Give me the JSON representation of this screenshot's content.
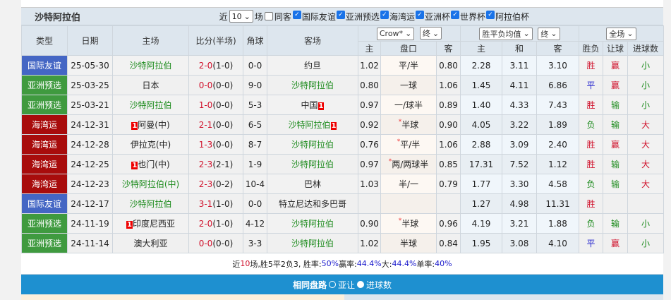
{
  "team": "沙特阿拉伯",
  "filters": {
    "near": "近",
    "count": "10",
    "unit": "场",
    "same_away": "同客",
    "leagues": [
      {
        "label": "国际友谊",
        "checked": true
      },
      {
        "label": "亚洲预选",
        "checked": true
      },
      {
        "label": "海湾运",
        "checked": true
      },
      {
        "label": "亚洲杯",
        "checked": true
      },
      {
        "label": "世界杯",
        "checked": true
      },
      {
        "label": "阿拉伯杯",
        "checked": true
      }
    ]
  },
  "header": {
    "type": "类型",
    "date": "日期",
    "home": "主场",
    "score": "比分(半场)",
    "corner": "角球",
    "away": "客场",
    "company": "Crow*",
    "final1": "终",
    "odds_type": "胜平负均值",
    "final2": "终",
    "scope": "全场",
    "sub": [
      "主",
      "盘口",
      "客",
      "主",
      "和",
      "客",
      "胜负",
      "让球",
      "进球数"
    ]
  },
  "colors": {
    "国际友谊": "#4466c4",
    "亚洲预选": "#3f9a3f",
    "海湾运": "#a80c0c"
  },
  "rows": [
    {
      "type": "国际友谊",
      "date": "25-05-30",
      "home": "沙特阿拉伯",
      "home_hl": true,
      "home_badge": "",
      "score": "2-0",
      "half": "(1-0)",
      "corner": "0-0",
      "away": "约旦",
      "away_hl": false,
      "away_badge": "",
      "h": "1.02",
      "line": "平/半",
      "star": false,
      "a": "0.80",
      "o1": "2.28",
      "o2": "3.11",
      "o3": "3.10",
      "res": "胜",
      "ah": "赢",
      "ou": "小"
    },
    {
      "type": "亚洲预选",
      "date": "25-03-25",
      "home": "日本",
      "home_hl": false,
      "home_badge": "",
      "score": "0-0",
      "half": "(0-0)",
      "corner": "9-0",
      "away": "沙特阿拉伯",
      "away_hl": true,
      "away_badge": "",
      "h": "0.80",
      "line": "一球",
      "star": false,
      "a": "1.06",
      "o1": "1.45",
      "o2": "4.11",
      "o3": "6.86",
      "res": "平",
      "ah": "赢",
      "ou": "小"
    },
    {
      "type": "亚洲预选",
      "date": "25-03-21",
      "home": "沙特阿拉伯",
      "home_hl": true,
      "home_badge": "",
      "score": "1-0",
      "half": "(0-0)",
      "corner": "5-3",
      "away": "中国",
      "away_hl": false,
      "away_badge": "1",
      "h": "0.97",
      "line": "一/球半",
      "star": false,
      "a": "0.89",
      "o1": "1.40",
      "o2": "4.33",
      "o3": "7.43",
      "res": "胜",
      "ah": "输",
      "ou": "小"
    },
    {
      "type": "海湾运",
      "date": "24-12-31",
      "home": "阿曼(中)",
      "home_hl": false,
      "home_badge": "1",
      "score": "2-1",
      "half": "(0-0)",
      "corner": "6-5",
      "away": "沙特阿拉伯",
      "away_hl": true,
      "away_badge": "1",
      "h": "0.92",
      "line": "半球",
      "star": true,
      "a": "0.90",
      "o1": "4.05",
      "o2": "3.22",
      "o3": "1.89",
      "res": "负",
      "ah": "输",
      "ou": "大"
    },
    {
      "type": "海湾运",
      "date": "24-12-28",
      "home": "伊拉克(中)",
      "home_hl": false,
      "home_badge": "",
      "score": "1-3",
      "half": "(0-0)",
      "corner": "8-7",
      "away": "沙特阿拉伯",
      "away_hl": true,
      "away_badge": "",
      "h": "0.76",
      "line": "平/半",
      "star": true,
      "a": "1.06",
      "o1": "2.88",
      "o2": "3.09",
      "o3": "2.40",
      "res": "胜",
      "ah": "赢",
      "ou": "大"
    },
    {
      "type": "海湾运",
      "date": "24-12-25",
      "home": "也门(中)",
      "home_hl": false,
      "home_badge": "1",
      "score": "2-3",
      "half": "(2-1)",
      "corner": "1-9",
      "away": "沙特阿拉伯",
      "away_hl": true,
      "away_badge": "",
      "h": "0.97",
      "line": "两/两球半",
      "star": true,
      "a": "0.85",
      "o1": "17.31",
      "o2": "7.52",
      "o3": "1.12",
      "res": "胜",
      "ah": "输",
      "ou": "大"
    },
    {
      "type": "海湾运",
      "date": "24-12-23",
      "home": "沙特阿拉伯(中)",
      "home_hl": true,
      "home_badge": "",
      "score": "2-3",
      "half": "(0-2)",
      "corner": "10-4",
      "away": "巴林",
      "away_hl": false,
      "away_badge": "",
      "h": "1.03",
      "line": "半/一",
      "star": false,
      "a": "0.79",
      "o1": "1.77",
      "o2": "3.30",
      "o3": "4.58",
      "res": "负",
      "ah": "输",
      "ou": "大"
    },
    {
      "type": "国际友谊",
      "date": "24-12-17",
      "home": "沙特阿拉伯",
      "home_hl": true,
      "home_badge": "",
      "score": "3-1",
      "half": "(1-0)",
      "corner": "0-0",
      "away": "特立尼达和多巴哥",
      "away_hl": false,
      "away_badge": "",
      "h": "",
      "line": "",
      "star": false,
      "a": "",
      "o1": "1.27",
      "o2": "4.98",
      "o3": "11.31",
      "res": "胜",
      "ah": "",
      "ou": ""
    },
    {
      "type": "亚洲预选",
      "date": "24-11-19",
      "home": "印度尼西亚",
      "home_hl": false,
      "home_badge": "1",
      "score": "2-0",
      "half": "(1-0)",
      "corner": "4-12",
      "away": "沙特阿拉伯",
      "away_hl": true,
      "away_badge": "",
      "h": "0.90",
      "line": "半球",
      "star": true,
      "a": "0.96",
      "o1": "4.19",
      "o2": "3.21",
      "o3": "1.88",
      "res": "负",
      "ah": "输",
      "ou": "小"
    },
    {
      "type": "亚洲预选",
      "date": "24-11-14",
      "home": "澳大利亚",
      "home_hl": false,
      "home_badge": "",
      "score": "0-0",
      "half": "(0-0)",
      "corner": "3-3",
      "away": "沙特阿拉伯",
      "away_hl": true,
      "away_badge": "",
      "h": "1.02",
      "line": "半球",
      "star": false,
      "a": "0.84",
      "o1": "1.95",
      "o2": "3.08",
      "o3": "4.10",
      "res": "平",
      "ah": "赢",
      "ou": "小"
    }
  ],
  "summary": {
    "p1": "近",
    "n": "10",
    "p2": "场,胜5平2负3, 胜率:",
    "win": "50%",
    "p3": " 赢率:",
    "ah": "44.4%",
    "p4": " 大:",
    "big": "44.4%",
    "p5": " 单率:",
    "odd": "40%"
  },
  "bar": {
    "title": "相同盘路",
    "opt1": "亚让",
    "opt2": "进球数"
  }
}
